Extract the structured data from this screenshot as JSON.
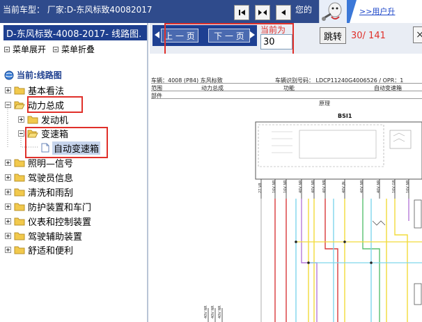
{
  "topbar": {
    "title": "当前车型：  厂家:D-东风标致40082017",
    "hint": "您的",
    "promo_link": ">>用户升"
  },
  "sidebar": {
    "header": "D-东风标致-4008-2017- 线路图.",
    "expand_label": "菜单展开",
    "collapse_label": "菜单折叠",
    "current_label": "当前:线路图",
    "items": [
      {
        "label": "基本看法"
      },
      {
        "label": "动力总成"
      },
      {
        "label": "发动机"
      },
      {
        "label": "变速箱"
      },
      {
        "label": "自动变速箱"
      },
      {
        "label": "照明—信号"
      },
      {
        "label": "驾驶员信息"
      },
      {
        "label": "清洗和雨刮"
      },
      {
        "label": "防护装置和车门"
      },
      {
        "label": "仪表和控制装置"
      },
      {
        "label": "驾驶辅助装置"
      },
      {
        "label": "舒适和便利"
      }
    ]
  },
  "nav": {
    "prev_label": "上 一 页",
    "next_label": "下 一 页",
    "current_label": "当前为",
    "current_value": "30",
    "jump_label": "跳转",
    "page_count": "30/ 141"
  },
  "document": {
    "row1_a": "车辆：4008 (P84) 东风标致",
    "row1_b": "车辆识别号码：  LDCP11240G4006526 / OPR：1",
    "row2_a": "范围",
    "row2_b": "动力总成",
    "row2_c": "功能",
    "row2_d": "自动变速箱",
    "row3_a": "部件",
    "section_title": "原理",
    "module_label": "BSI1"
  },
  "colors": {
    "topbar_bg": "#2f4b8c",
    "sidebar_header_bg": "#1e3f8f",
    "highlight_red": "#e0302a",
    "wire_yellow": "#f2dc3a",
    "wire_cyan": "#7fd6ec",
    "wire_red": "#d8383a",
    "wire_purple": "#b77ad8",
    "wire_green": "#58c070"
  }
}
